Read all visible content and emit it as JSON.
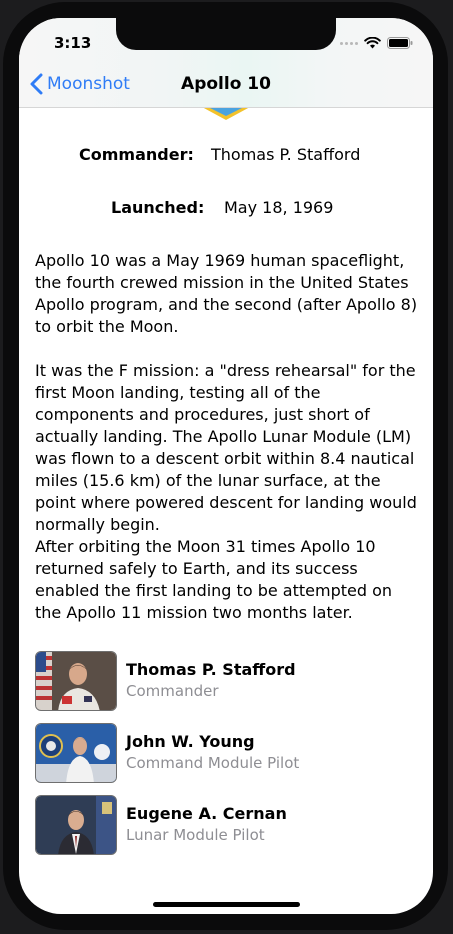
{
  "status_bar": {
    "time": "3:13"
  },
  "nav": {
    "back_label": "Moonshot",
    "title": "Apollo 10"
  },
  "mission": {
    "commander_label": "Commander:",
    "commander_value": "Thomas P. Stafford",
    "launched_label": "Launched:",
    "launched_value": "May 18, 1969",
    "paragraphs": [
      "Apollo 10 was a May 1969 human spaceflight, the fourth crewed mission in the United States Apollo program, and the second (after Apollo 8) to orbit the Moon.",
      "It was the F mission: a \"dress rehearsal\" for the first Moon landing, testing all of the components and procedures, just short of actually landing. The Apollo Lunar Module (LM) was flown to a descent orbit within 8.4 nautical miles (15.6 km) of the lunar surface, at the point where powered descent for landing would normally begin.",
      "After orbiting the Moon 31 times Apollo 10 returned safely to Earth, and its success enabled the first landing to be attempted on the Apollo 11 mission two months later."
    ]
  },
  "crew": [
    {
      "name": "Thomas P. Stafford",
      "role": "Commander"
    },
    {
      "name": "John W. Young",
      "role": "Command Module Pilot"
    },
    {
      "name": "Eugene A. Cernan",
      "role": "Lunar Module Pilot"
    }
  ],
  "colors": {
    "accent": "#2f7cf6",
    "secondary_text": "#8e8e93",
    "badge_yellow": "#f3c22b",
    "badge_blue": "#4aa3df"
  },
  "icons": {
    "back": "chevron-left-icon",
    "wifi": "wifi-icon",
    "battery": "battery-icon",
    "signal": "cellular-signal-icon"
  }
}
